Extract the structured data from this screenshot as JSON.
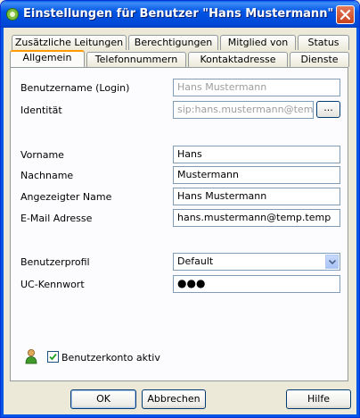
{
  "window": {
    "title": "Einstellungen für Benutzer \"Hans Mustermann\""
  },
  "tabs_row1": [
    "Zusätzliche Leitungen",
    "Berechtigungen",
    "Mitglied von",
    "Status"
  ],
  "tabs_row2": [
    "Allgemein",
    "Telefonnummern",
    "Kontaktadresse",
    "Dienste"
  ],
  "form": {
    "login": {
      "label": "Benutzername (Login)",
      "value": "Hans Mustermann"
    },
    "identity": {
      "label": "Identität",
      "value": "sip:hans.mustermann@temp.te",
      "button": "..."
    },
    "firstname": {
      "label": "Vorname",
      "value": "Hans"
    },
    "lastname": {
      "label": "Nachname",
      "value": "Mustermann"
    },
    "displayname": {
      "label": "Angezeigter Name",
      "value": "Hans Mustermann"
    },
    "email": {
      "label": "E-Mail Adresse",
      "value": "hans.mustermann@temp.temp"
    },
    "profile": {
      "label": "Benutzerprofil",
      "value": "Default"
    },
    "password": {
      "label": "UC-Kennwort",
      "value": "●●●"
    },
    "active": {
      "label": "Benutzerkonto aktiv",
      "checked": true
    }
  },
  "buttons": {
    "ok": "OK",
    "cancel": "Abbrechen",
    "help": "Hilfe"
  },
  "colors": {
    "titlebar": "#0055e5",
    "active_tab_accent": "#ff9a00",
    "close": "#c8411c"
  }
}
